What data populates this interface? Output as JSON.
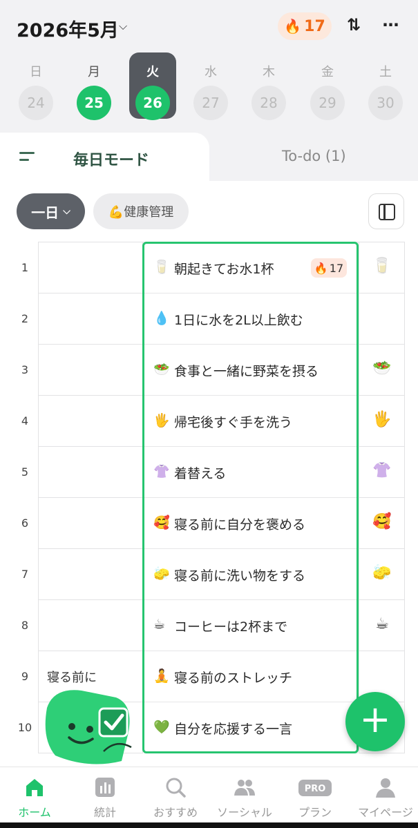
{
  "header": {
    "month_label": "2026年5月",
    "streak_count": "17"
  },
  "week": [
    {
      "dow": "日",
      "date": "24",
      "state": "future"
    },
    {
      "dow": "月",
      "date": "25",
      "state": "done"
    },
    {
      "dow": "火",
      "date": "26",
      "state": "selected"
    },
    {
      "dow": "水",
      "date": "27",
      "state": "future"
    },
    {
      "dow": "木",
      "date": "28",
      "state": "future"
    },
    {
      "dow": "金",
      "date": "29",
      "state": "future"
    },
    {
      "dow": "土",
      "date": "30",
      "state": "future"
    }
  ],
  "tabs": {
    "daily_label": "毎日モード",
    "todo_label": "To-do (1)"
  },
  "filters": {
    "range_label": "一日",
    "tag_label": "💪健康管理"
  },
  "rows": [
    {
      "num": "1",
      "left": "",
      "emoji": "🥛",
      "habit": "朝起きてお水1杯",
      "badge": "17",
      "right": "🥛"
    },
    {
      "num": "2",
      "left": "",
      "emoji": "💧",
      "habit": "1日に水を2L以上飲む",
      "badge": "",
      "right": ""
    },
    {
      "num": "3",
      "left": "",
      "emoji": "🥗",
      "habit": "食事と一緒に野菜を摂る",
      "badge": "",
      "right": "🥗"
    },
    {
      "num": "4",
      "left": "",
      "emoji": "🖐",
      "habit": "帰宅後すぐ手を洗う",
      "badge": "",
      "right": "🖐"
    },
    {
      "num": "5",
      "left": "",
      "emoji": "👚",
      "habit": "着替える",
      "badge": "",
      "right": "👚"
    },
    {
      "num": "6",
      "left": "",
      "emoji": "🥰",
      "habit": "寝る前に自分を褒める",
      "badge": "",
      "right": "🥰"
    },
    {
      "num": "7",
      "left": "",
      "emoji": "🧽",
      "habit": "寝る前に洗い物をする",
      "badge": "",
      "right": "🧽"
    },
    {
      "num": "8",
      "left": "",
      "emoji": "☕",
      "habit": "コーヒーは2杯まで",
      "badge": "",
      "right": "☕"
    },
    {
      "num": "9",
      "left": "寝る前に",
      "emoji": "🧘",
      "habit": "寝る前のストレッチ",
      "badge": "",
      "right": ""
    },
    {
      "num": "10",
      "left": "",
      "emoji": "💚",
      "habit": "自分を応援する一言",
      "badge": "",
      "right": ""
    }
  ],
  "nav": [
    {
      "label": "ホーム",
      "icon": "home-icon",
      "active": true
    },
    {
      "label": "統計",
      "icon": "stats-icon",
      "active": false
    },
    {
      "label": "おすすめ",
      "icon": "search-icon",
      "active": false
    },
    {
      "label": "ソーシャル",
      "icon": "people-icon",
      "active": false
    },
    {
      "label": "プラン",
      "icon": "pro-icon",
      "active": false
    },
    {
      "label": "マイページ",
      "icon": "person-icon",
      "active": false
    }
  ],
  "colors": {
    "accent": "#1ec26b",
    "selected_day": "#55595f",
    "streak_bg": "#fde8dc",
    "streak_text": "#f06a17"
  }
}
